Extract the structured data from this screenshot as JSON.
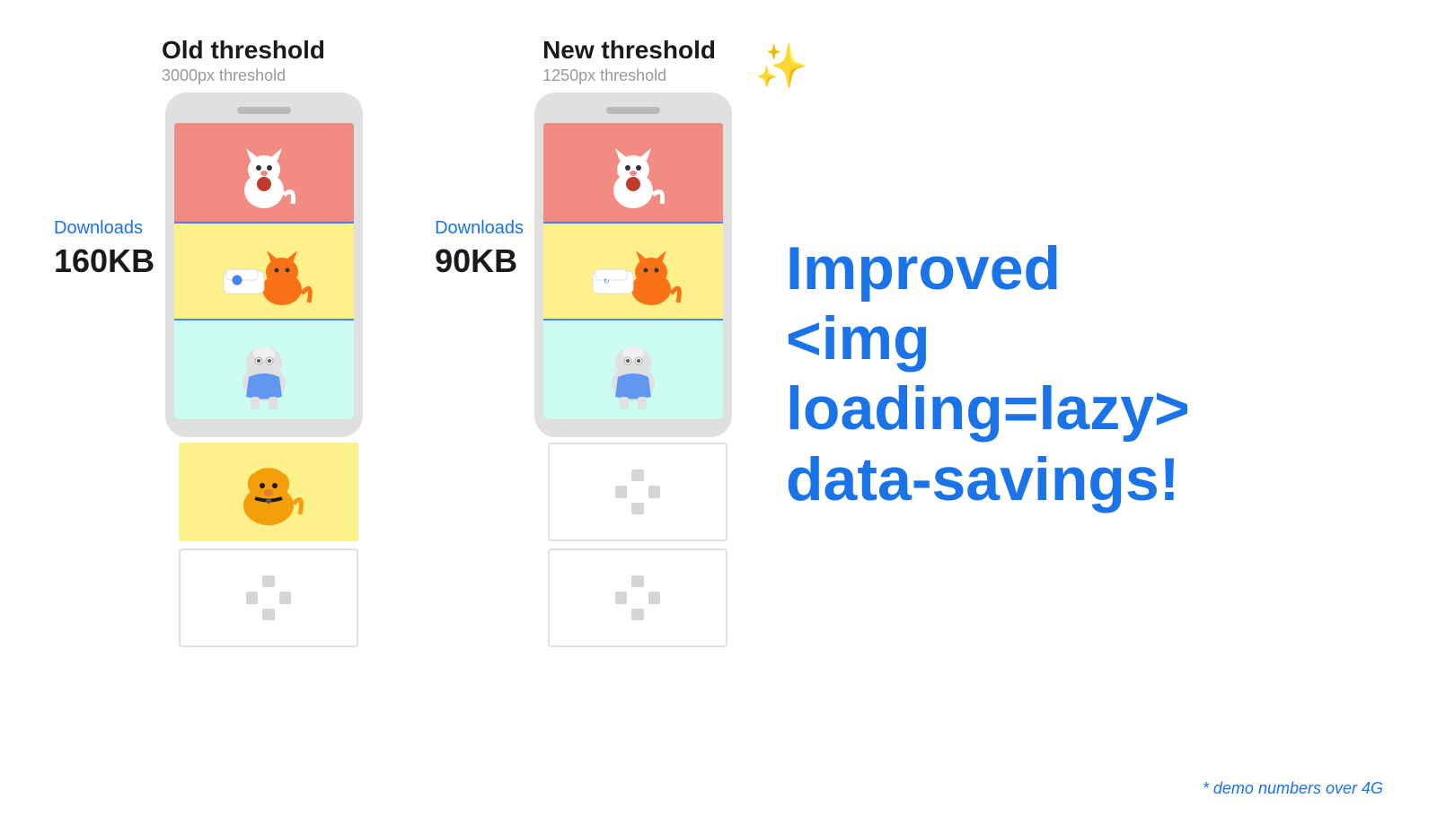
{
  "old_threshold": {
    "title": "Old threshold",
    "subtitle": "3000px threshold",
    "downloads_label": "Downloads",
    "downloads_size": "160KB"
  },
  "new_threshold": {
    "title": "New threshold",
    "subtitle": "1250px threshold",
    "downloads_label": "Downloads",
    "downloads_size": "90KB"
  },
  "hero_text_line1": "Improved",
  "hero_text_line2": "<img loading=lazy>",
  "hero_text_line3": "data-savings!",
  "demo_note": "* demo numbers over 4G",
  "sparkle_emoji": "✨"
}
